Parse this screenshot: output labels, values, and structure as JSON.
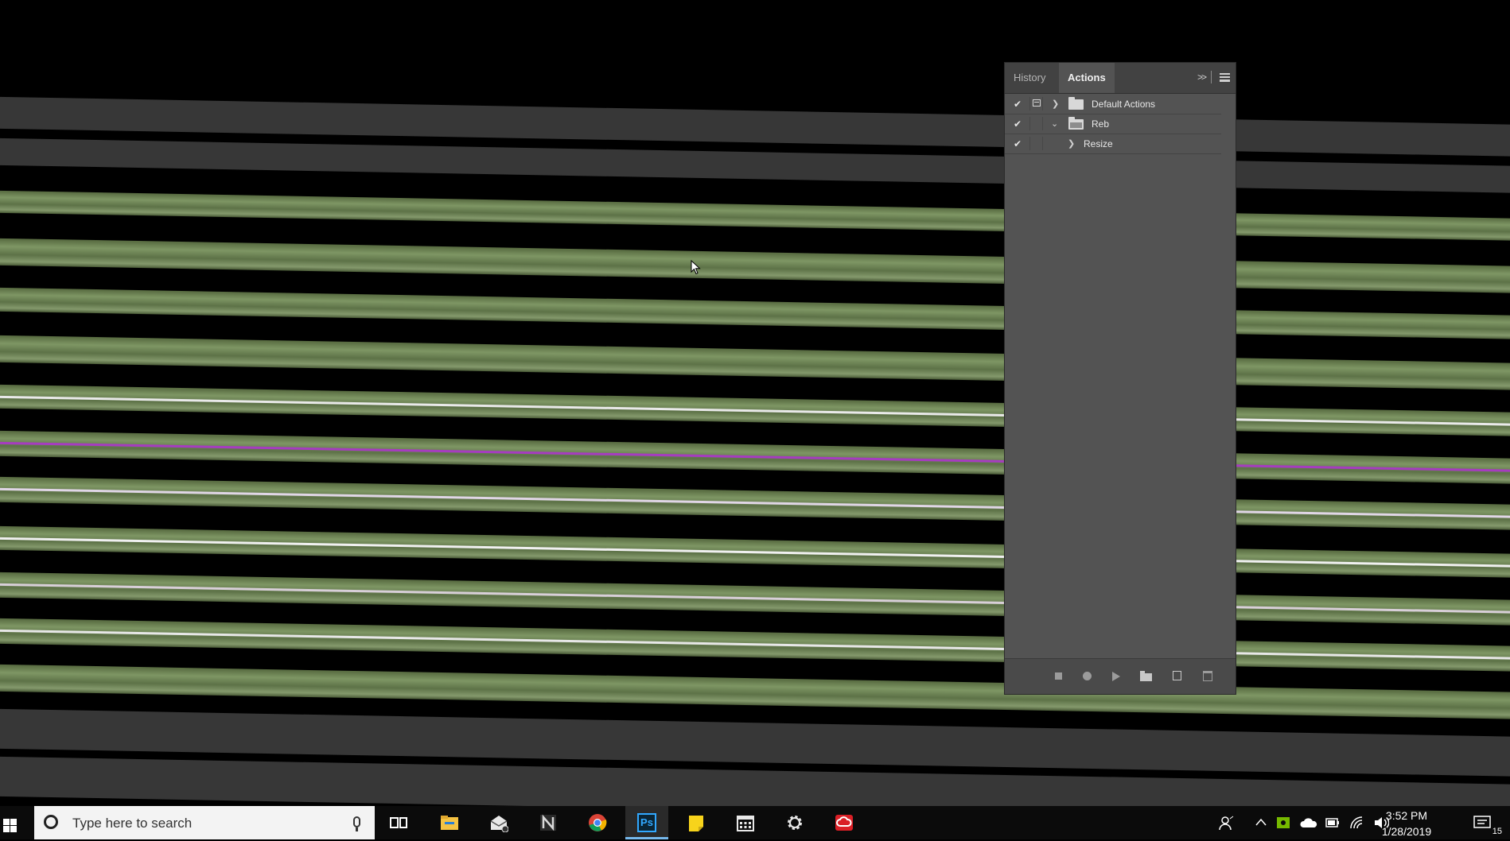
{
  "panel": {
    "tabs": [
      {
        "label": "History",
        "active": false
      },
      {
        "label": "Actions",
        "active": true
      }
    ],
    "collapse_glyph": ">>",
    "rows": [
      {
        "label": "Default Actions",
        "checked": true,
        "expanded": false,
        "type": "set"
      },
      {
        "label": "Reb",
        "checked": true,
        "expanded": true,
        "type": "set"
      },
      {
        "label": "Resize",
        "checked": true,
        "expanded": false,
        "type": "action"
      }
    ],
    "footer_buttons": [
      "stop",
      "record",
      "play",
      "new-set",
      "new-action",
      "delete"
    ]
  },
  "taskbar": {
    "search_placeholder": "Type here to search",
    "pinned_apps": [
      "task-view",
      "file-explorer",
      "mail",
      "notion",
      "chrome",
      "photoshop",
      "sticky-notes",
      "calendar",
      "settings",
      "creative-cloud"
    ],
    "active_app": "photoshop",
    "photoshop_label": "Ps",
    "clock": {
      "time": "3:52 PM",
      "date": "1/28/2019"
    },
    "notification_count": "15"
  },
  "colors": {
    "panel_bg": "#535353",
    "tab_bar": "#424242",
    "stripe_green": "#7e9664",
    "stripe_gray": "#373737",
    "thread_magenta": "#a63cc0",
    "taskbar_bg": "#0b0b0b",
    "ps_accent": "#31a8ff"
  }
}
